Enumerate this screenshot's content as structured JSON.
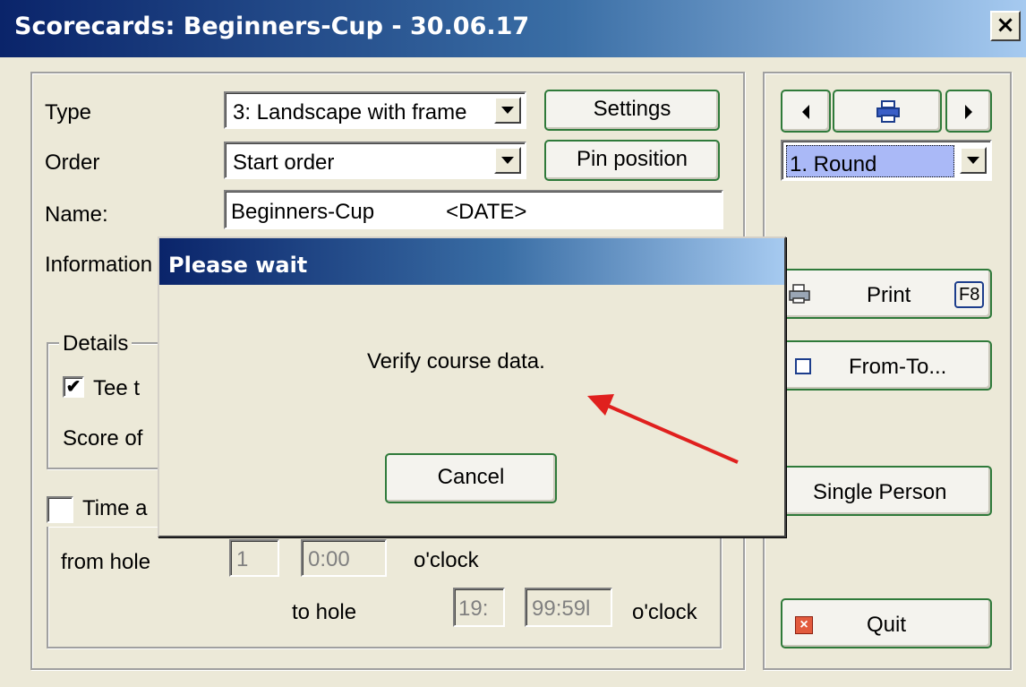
{
  "window": {
    "title": "Scorecards: Beginners-Cup - 30.06.17",
    "close_label": "×"
  },
  "form": {
    "type_label": "Type",
    "type_value": "3: Landscape with frame",
    "order_label": "Order",
    "order_value": "Start order",
    "name_label": "Name:",
    "name_value": "Beginners-Cup            <DATE>",
    "information_label": "Information",
    "settings_button": "Settings",
    "pin_position_button": "Pin position"
  },
  "details": {
    "group_label": "Details",
    "tee_time_label": "Tee t",
    "tee_time_checked": true,
    "score_label": "Score of"
  },
  "time": {
    "label": "Time a",
    "checked": false,
    "from_hole_label": "from hole",
    "from_hole_value": "1",
    "from_time_value": "0:00",
    "oclock_1": "o'clock",
    "to_hole_label": "to hole",
    "to_hole_value": "19:",
    "to_time_value": "99:59l",
    "oclock_2": "o'clock"
  },
  "right_panel": {
    "round_value": "1. Round",
    "print_label": "Print",
    "print_shortcut": "F8",
    "from_to_label": "From-To...",
    "single_person_label": "Single Person",
    "quit_label": "Quit"
  },
  "dialog": {
    "title": "Please wait",
    "message": "Verify course data.",
    "cancel_label": "Cancel"
  },
  "colors": {
    "accent": "#0a246a",
    "button_border": "#2f7a3a",
    "arrow": "#e0201e"
  }
}
